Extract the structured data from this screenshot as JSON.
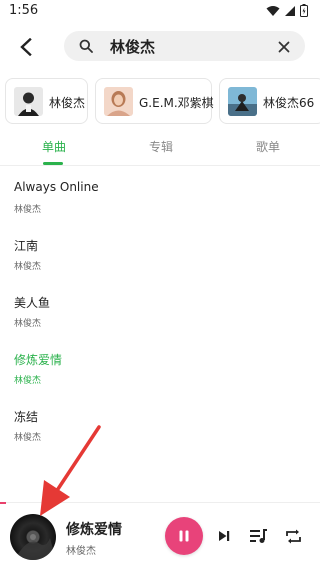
{
  "status_bar": {
    "time": "1:56"
  },
  "search": {
    "query": "林俊杰"
  },
  "artists": [
    {
      "name": "林俊杰"
    },
    {
      "name": "G.E.M.邓紫棋"
    },
    {
      "name": "林俊杰66"
    }
  ],
  "tabs": [
    {
      "label": "单曲",
      "active": true
    },
    {
      "label": "专辑",
      "active": false
    },
    {
      "label": "歌单",
      "active": false
    }
  ],
  "songs": [
    {
      "title": "Always Online",
      "artist": "林俊杰",
      "playing": false
    },
    {
      "title": "江南",
      "artist": "林俊杰",
      "playing": false
    },
    {
      "title": "美人鱼",
      "artist": "林俊杰",
      "playing": false
    },
    {
      "title": "修炼爱情",
      "artist": "林俊杰",
      "playing": true
    },
    {
      "title": "冻结",
      "artist": "林俊杰",
      "playing": false
    }
  ],
  "player": {
    "title": "修炼爱情",
    "artist": "林俊杰",
    "state": "playing"
  },
  "colors": {
    "accent_green": "#2bb24c",
    "play_button": "#e8437a",
    "annotation_arrow": "#e53935"
  },
  "icons": {
    "back": "arrow-back-icon",
    "search": "search-icon",
    "clear": "close-icon",
    "pause": "pause-icon",
    "next": "skip-next-icon",
    "playlist": "playlist-icon",
    "repeat": "repeat-icon"
  }
}
